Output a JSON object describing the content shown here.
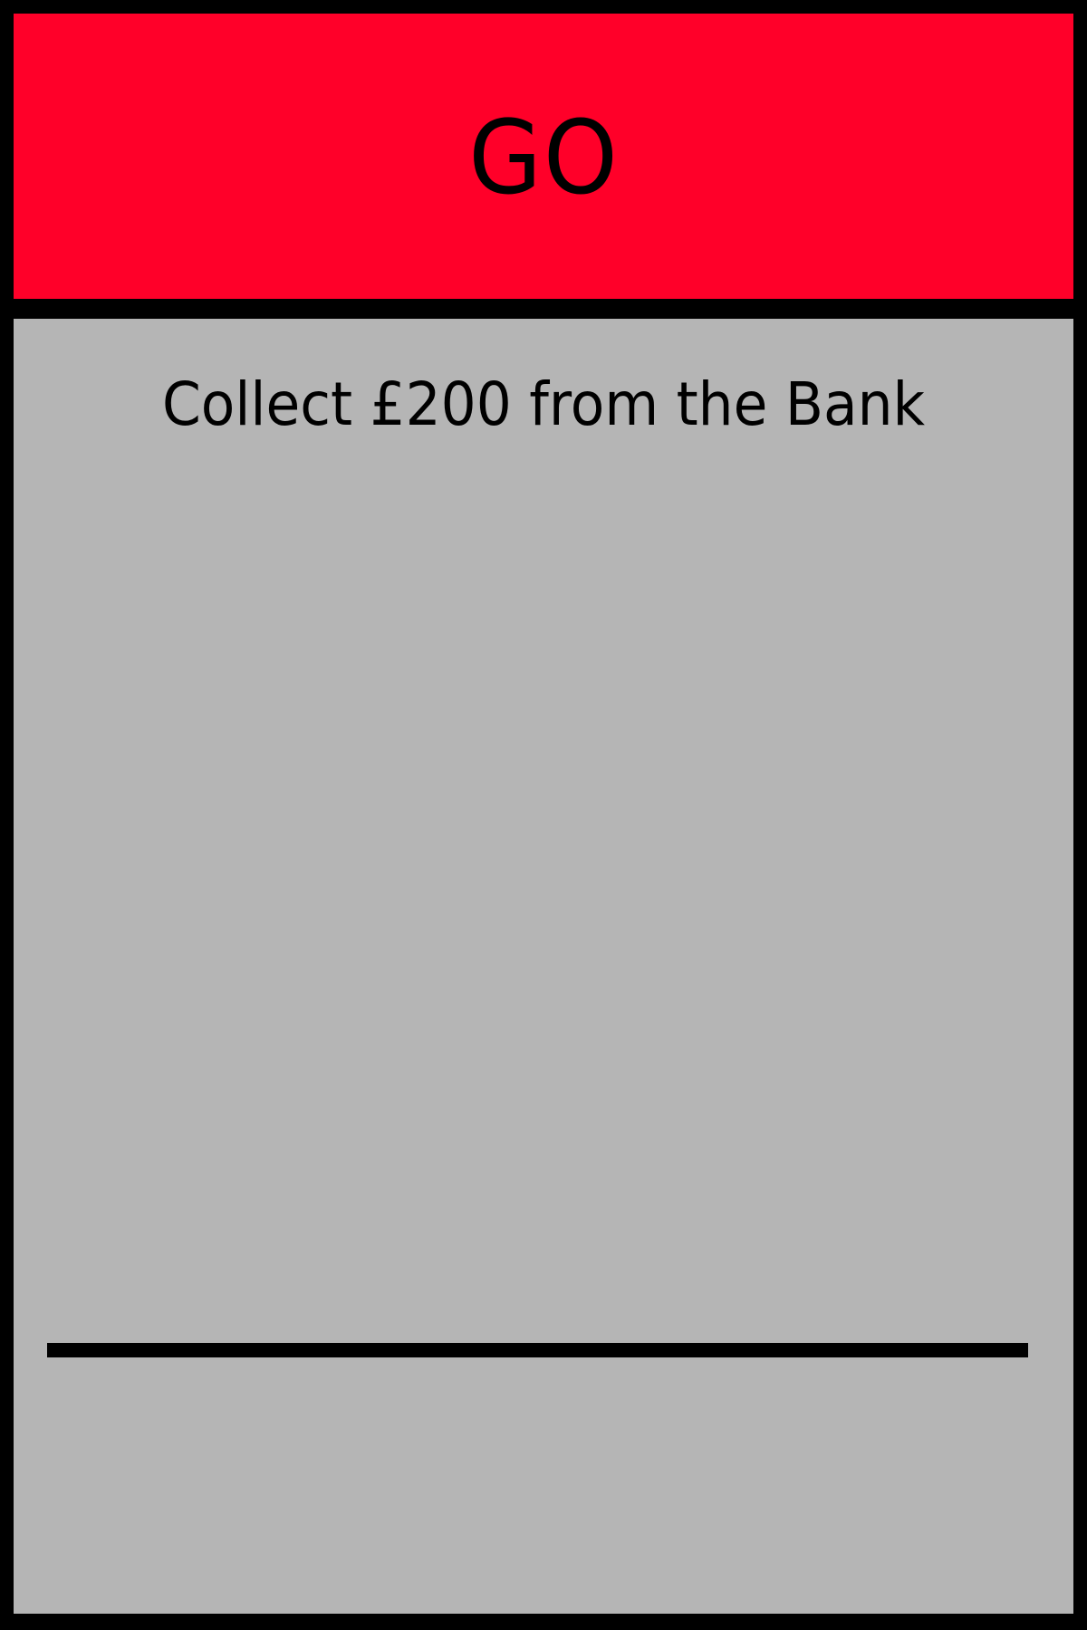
{
  "card": {
    "title": "GO",
    "instruction": "Collect £200 from the Bank",
    "price": ""
  },
  "colors": {
    "border": "#000000",
    "header_band": "#FF0029",
    "body_fill": "#B5B5B5",
    "text": "#000000"
  }
}
